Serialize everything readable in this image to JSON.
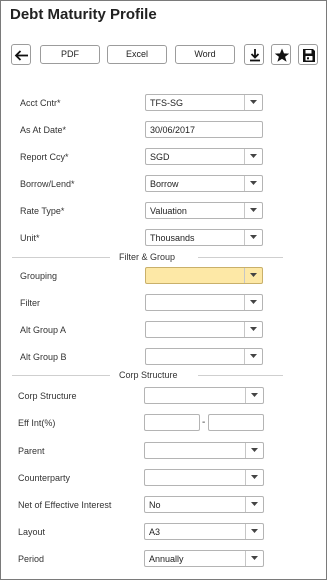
{
  "page": {
    "title": "Debt Maturity Profile"
  },
  "toolbar": {
    "back_icon": "arrow-left-icon",
    "pdf_label": "PDF",
    "excel_label": "Excel",
    "word_label": "Word",
    "download_icon": "download-icon",
    "favorite_icon": "star-icon",
    "save_icon": "floppy-disk-icon"
  },
  "form": {
    "acct_cntr": {
      "label": "Acct Cntr*",
      "value": "TFS-SG"
    },
    "as_at_date": {
      "label": "As At Date*",
      "value": "30/06/2017"
    },
    "report_ccy": {
      "label": "Report Ccy*",
      "value": "SGD"
    },
    "borrow_lend": {
      "label": "Borrow/Lend*",
      "value": "Borrow"
    },
    "rate_type": {
      "label": "Rate Type*",
      "value": "Valuation"
    },
    "unit": {
      "label": "Unit*",
      "value": "Thousands"
    }
  },
  "filter_group": {
    "heading": "Filter & Group",
    "grouping": {
      "label": "Grouping",
      "value": ""
    },
    "filter": {
      "label": "Filter",
      "value": ""
    },
    "alt_group_a": {
      "label": "Alt Group A",
      "value": ""
    },
    "alt_group_b": {
      "label": "Alt Group B",
      "value": ""
    }
  },
  "corp_structure": {
    "heading": "Corp Structure",
    "corp_structure": {
      "label": "Corp Structure",
      "value": ""
    },
    "eff_int": {
      "label": "Eff Int(%)",
      "from": "",
      "separator": "-",
      "to": ""
    },
    "parent": {
      "label": "Parent",
      "value": ""
    },
    "counterparty": {
      "label": "Counterparty",
      "value": ""
    },
    "net_of_effective_interest": {
      "label": "Net of Effective Interest",
      "value": "No"
    },
    "layout": {
      "label": "Layout",
      "value": "A3"
    },
    "period": {
      "label": "Period",
      "value": "Annually"
    }
  }
}
